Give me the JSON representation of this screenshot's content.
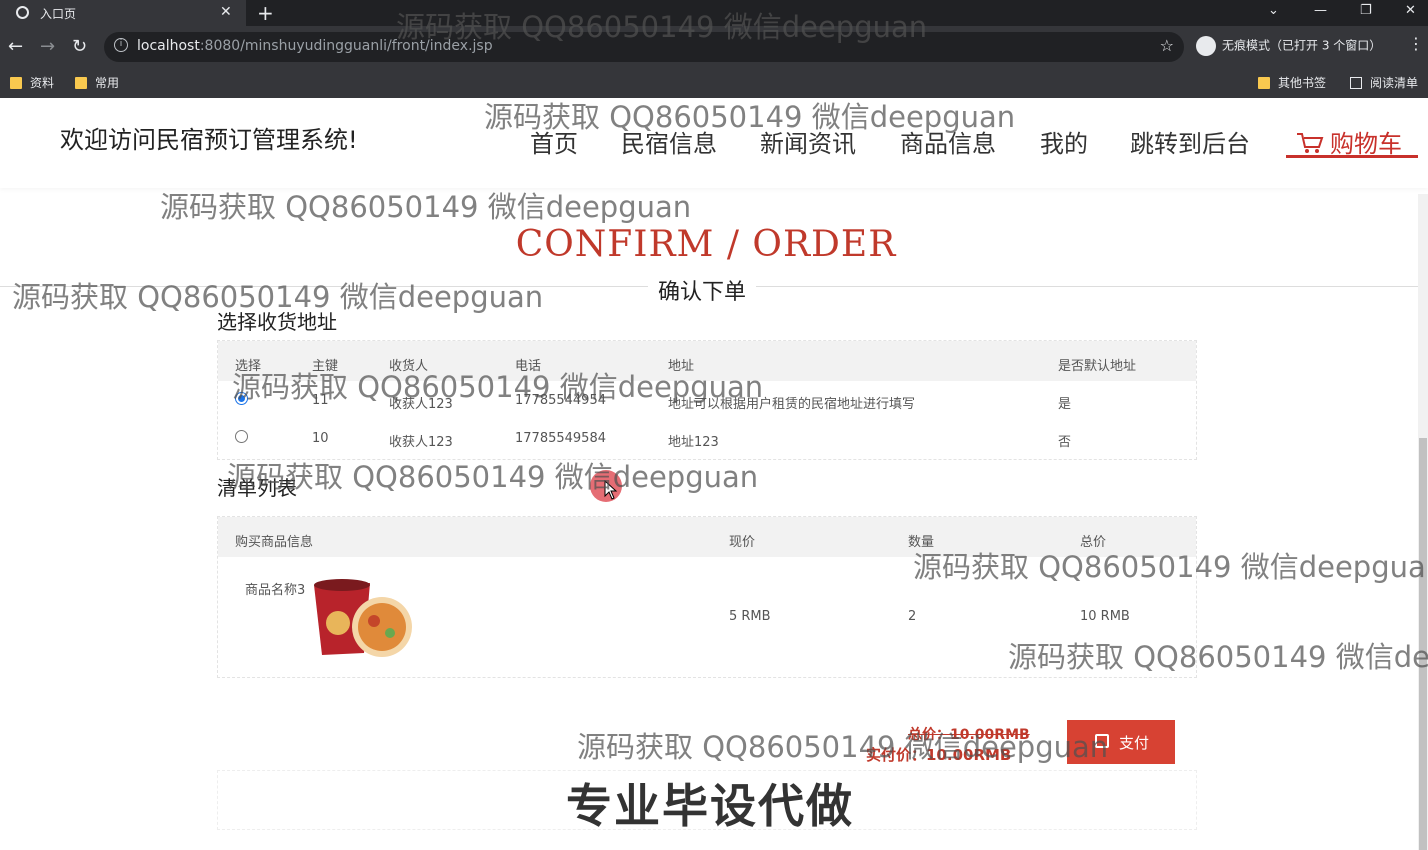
{
  "browser": {
    "tab_title": "入口页",
    "url_host": "localhost",
    "url_path": ":8080/minshuyudingguanli/front/index.jsp",
    "incognito_label": "无痕模式（已打开 3 个窗口）",
    "bookmarks": [
      "资料",
      "常用"
    ],
    "bookmarks_right": [
      "其他书签",
      "阅读清单"
    ]
  },
  "header": {
    "welcome": "欢迎访问民宿预订管理系统!",
    "nav": [
      "首页",
      "民宿信息",
      "新闻资讯",
      "商品信息",
      "我的",
      "跳转到后台"
    ],
    "cart": "购物车"
  },
  "main": {
    "title_en": "CONFIRM / ORDER",
    "title_cn": "确认下单",
    "address_section": "选择收货地址",
    "address_headers": [
      "选择",
      "主键",
      "收货人",
      "电话",
      "地址",
      "是否默认地址"
    ],
    "addresses": [
      {
        "selected": true,
        "id": "11",
        "name": "收获人123",
        "phone": "17785544954",
        "address": "地址可以根据用户租赁的民宿地址进行填写",
        "default": "是"
      },
      {
        "selected": false,
        "id": "10",
        "name": "收获人123",
        "phone": "17785549584",
        "address": "地址123",
        "default": "否"
      }
    ],
    "list_section": "清单列表",
    "item_headers": [
      "购买商品信息",
      "现价",
      "数量",
      "总价"
    ],
    "items": [
      {
        "name": "商品名称3",
        "price": "5 RMB",
        "qty": "2",
        "total": "10 RMB"
      }
    ],
    "total_label": "总价：10.00RMB",
    "actual_label": "实付价：10.00RMB",
    "pay_button": "支付"
  },
  "overlay": {
    "watermark": "源码获取 QQ86050149 微信deepguan",
    "watermark_cut1": "源码获取 QQ86050149 微信deepgua",
    "watermark_cut2": "源码获取 QQ86050149 微信de",
    "banner": "专业毕设代做"
  },
  "colors": {
    "accent": "#c0392b",
    "pay_button": "#d74233",
    "browser_dark": "#202124"
  }
}
